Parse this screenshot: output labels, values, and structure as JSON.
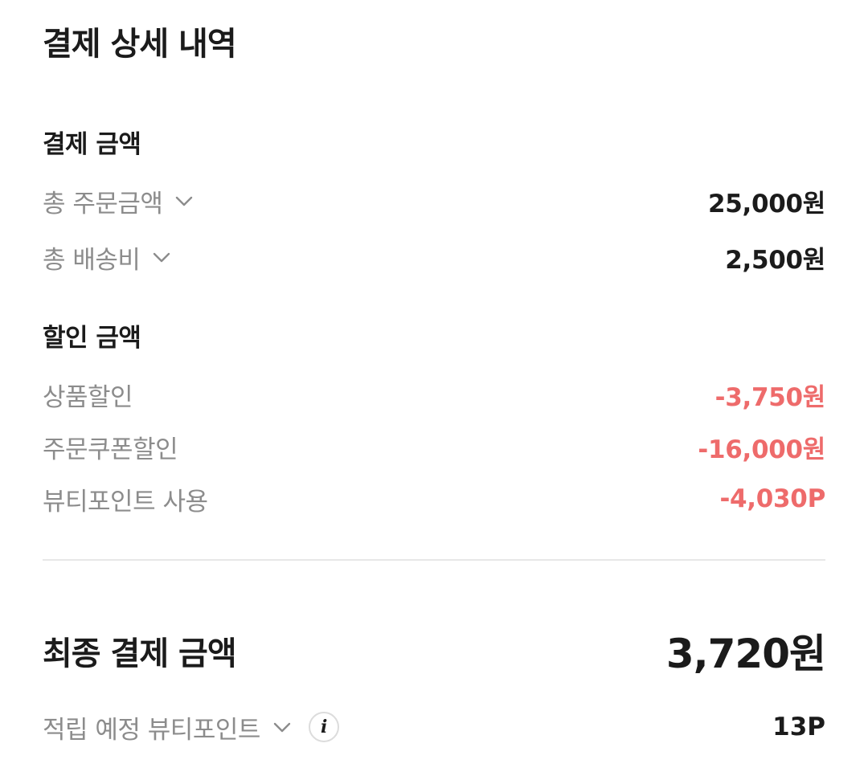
{
  "header": {
    "title": "결제 상세 내역"
  },
  "payment_amount": {
    "section_title": "결제 금액",
    "rows": [
      {
        "label": "총 주문금액",
        "value": "25,000원",
        "expandable": true,
        "icon": "chevron-down-icon"
      },
      {
        "label": "총 배송비",
        "value": "2,500원",
        "expandable": true,
        "icon": "chevron-down-icon"
      }
    ]
  },
  "discount_amount": {
    "section_title": "할인 금액",
    "rows": [
      {
        "label": "상품할인",
        "value": "-3,750원"
      },
      {
        "label": "주문쿠폰할인",
        "value": "-16,000원"
      },
      {
        "label": "뷰티포인트 사용",
        "value": "-4,030P"
      }
    ]
  },
  "final": {
    "label": "최종 결제 금액",
    "value": "3,720원"
  },
  "points": {
    "label": "적립 예정 뷰티포인트",
    "value": "13P",
    "icon": "info-icon",
    "icon_glyph": "i"
  },
  "colors": {
    "text_primary": "#1b1b1b",
    "text_secondary": "#8c8c8c",
    "discount": "#ee6b6b",
    "divider": "#e7e7e7"
  }
}
